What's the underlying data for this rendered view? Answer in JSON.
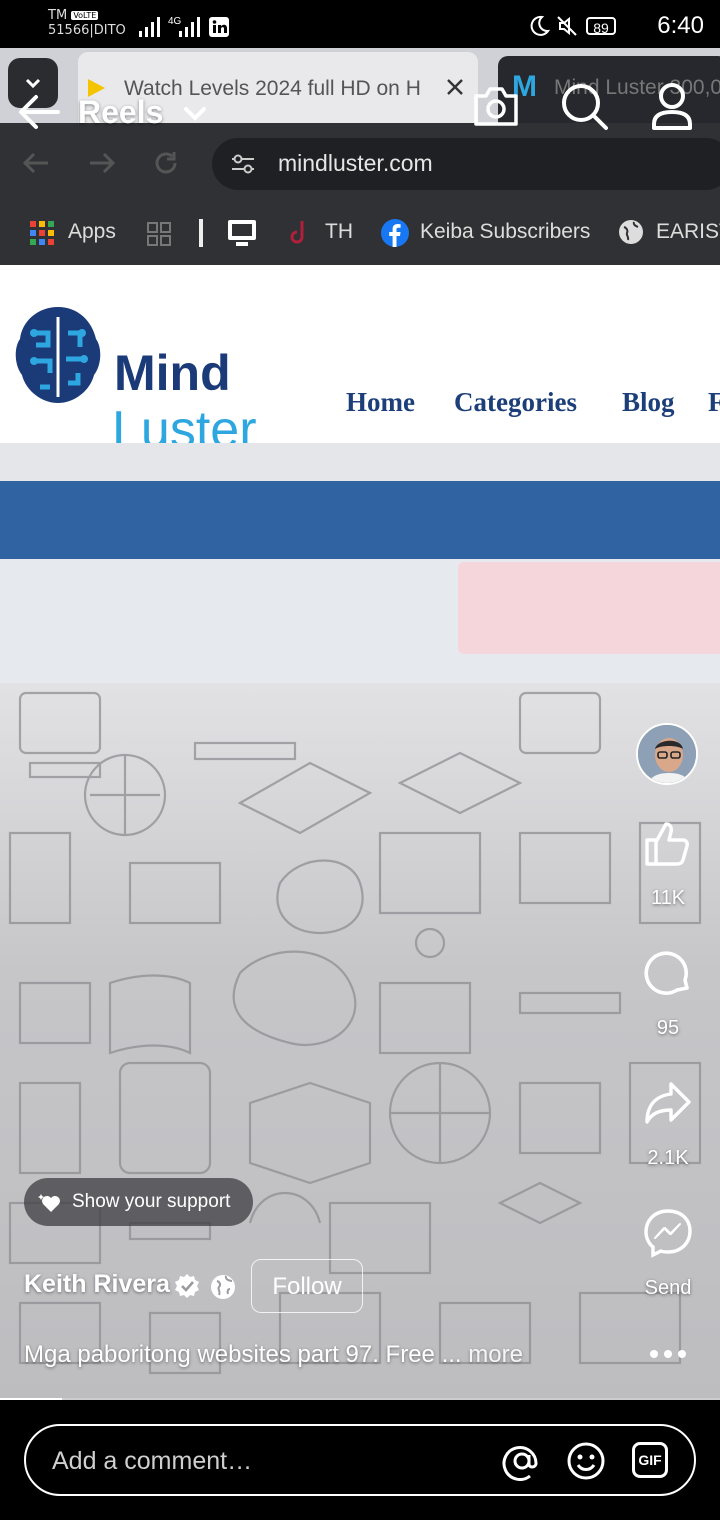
{
  "status_bar": {
    "carrier_line1": "TM",
    "carrier_line2": "51566|DITO",
    "network_badge": "VoLTE",
    "signal_badge": "4G",
    "battery": "89",
    "time": "6:40"
  },
  "browser": {
    "active_tab_title": "Watch Levels 2024 full HD on H",
    "second_tab_title": "Mind Luster 300,0",
    "url": "mindluster.com",
    "bookmarks": [
      "Apps",
      "TH",
      "Keiba Subscribers",
      "EARIST"
    ]
  },
  "website": {
    "logo_word1": "Mind",
    "logo_word2": "Luster",
    "nav": [
      "Home",
      "Categories",
      "Blog",
      "F"
    ]
  },
  "reels_header": {
    "title": "Reels"
  },
  "actions": {
    "likes": "11K",
    "comments": "95",
    "shares": "2.1K",
    "send_label": "Send"
  },
  "post": {
    "support_label": "Show your support",
    "author": "Keith Rivera",
    "follow_label": "Follow",
    "caption": "Mga paboritong websites part 97. Free ...",
    "more_label": "more"
  },
  "comment_bar": {
    "placeholder": "Add a comment…",
    "gif_label": "GIF"
  },
  "colors": {
    "site_blue": "#2f63a2",
    "logo_dark": "#1b3a78",
    "logo_light": "#2ea6e0",
    "nav_text": "#1c3f7a"
  }
}
